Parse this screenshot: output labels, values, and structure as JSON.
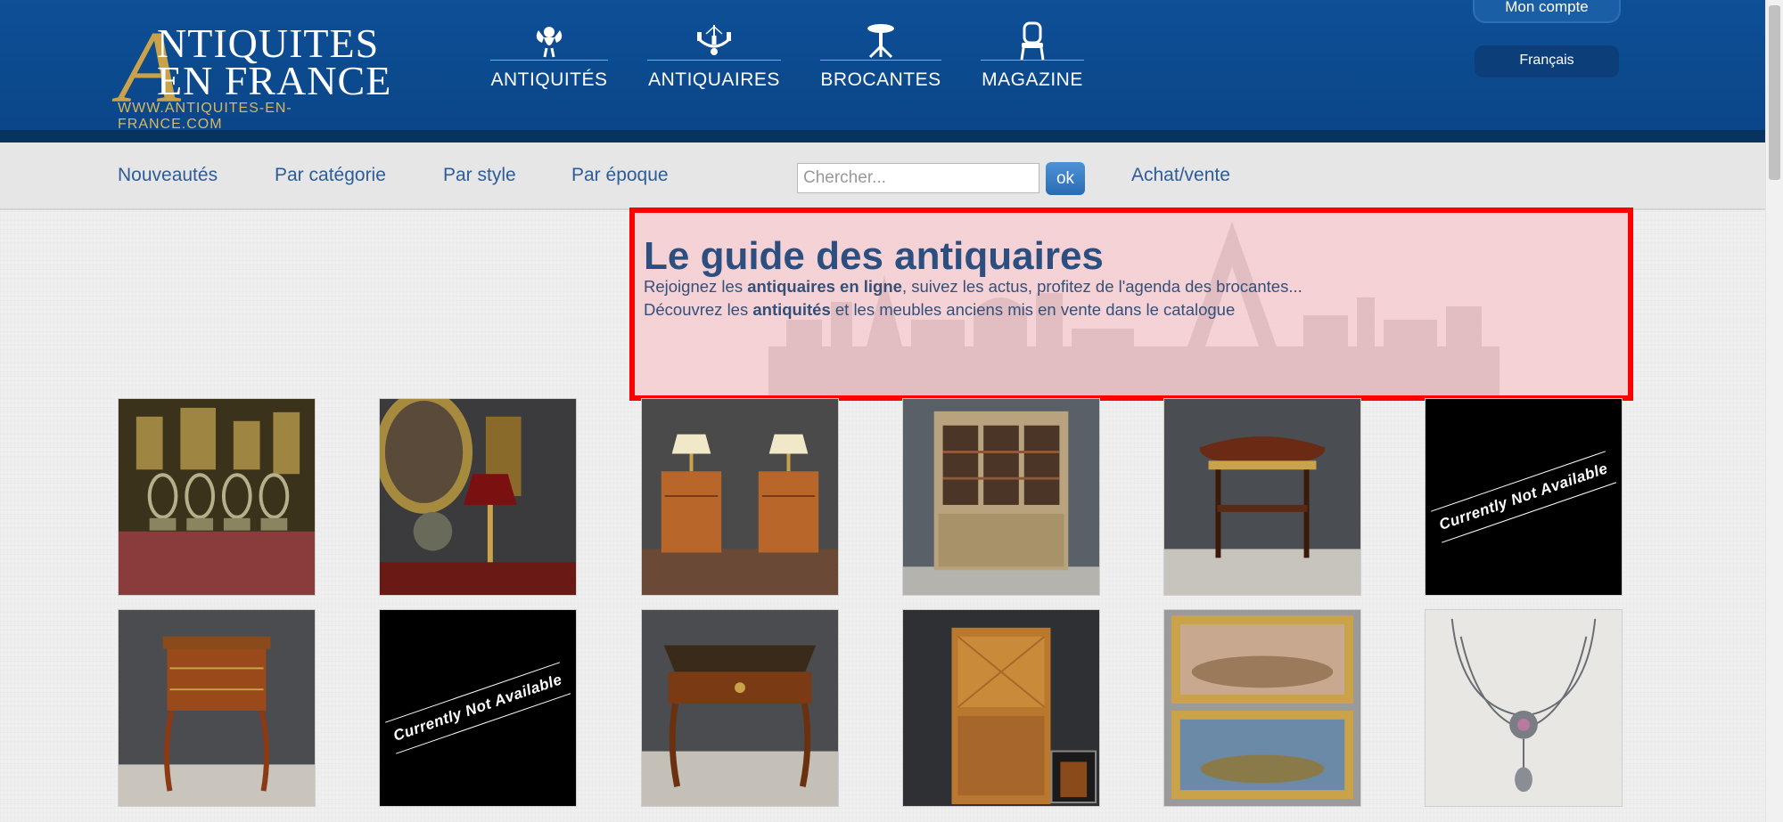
{
  "header": {
    "logo": {
      "big_letter": "A",
      "line1": "NTIQUITES",
      "line2": "EN FRANCE",
      "url": "WWW.ANTIQUITES-EN-FRANCE.COM"
    },
    "nav": [
      {
        "label": "ANTIQUITÉS",
        "icon": "cherub-icon"
      },
      {
        "label": "ANTIQUAIRES",
        "icon": "chandelier-icon"
      },
      {
        "label": "BROCANTES",
        "icon": "pedestal-table-icon"
      },
      {
        "label": "MAGAZINE",
        "icon": "chair-icon"
      }
    ],
    "account_label": "Mon compte",
    "language_label": "Français"
  },
  "subnav": {
    "links": [
      "Nouveautés",
      "Par catégorie",
      "Par style",
      "Par époque"
    ],
    "search_placeholder": "Chercher...",
    "search_button": "ok",
    "buy_sell": "Achat/vente"
  },
  "guide": {
    "title": "Le guide des antiquaires",
    "line1_pre": "Rejoignez les ",
    "line1_bold": "antiquaires en ligne",
    "line1_post": ", suivez les actus, profitez de l'agenda des brocantes...",
    "line2_pre": "Découvrez les ",
    "line2_bold": "antiquités",
    "line2_post": " et les meubles anciens mis en vente dans le catalogue"
  },
  "products": {
    "not_available_text": "Currently Not Available",
    "items": [
      {
        "name": "product-chairs-tapestry",
        "available": true
      },
      {
        "name": "product-bouillotte-lamp",
        "available": true
      },
      {
        "name": "product-bedside-tables",
        "available": true
      },
      {
        "name": "product-bookcase",
        "available": true
      },
      {
        "name": "product-kidney-table",
        "available": true
      },
      {
        "name": "product-unavailable-1",
        "available": false
      },
      {
        "name": "product-marquetry-table",
        "available": true
      },
      {
        "name": "product-unavailable-2",
        "available": false
      },
      {
        "name": "product-louis-xv-desk",
        "available": true
      },
      {
        "name": "product-secretary",
        "available": true
      },
      {
        "name": "product-framed-paintings",
        "available": true
      },
      {
        "name": "product-necklace",
        "available": true
      }
    ]
  },
  "colors": {
    "header_blue": "#0e4f96",
    "logo_gold": "#c9a24a",
    "link_blue": "#2d5c99",
    "highlight_red": "#ff0000"
  }
}
